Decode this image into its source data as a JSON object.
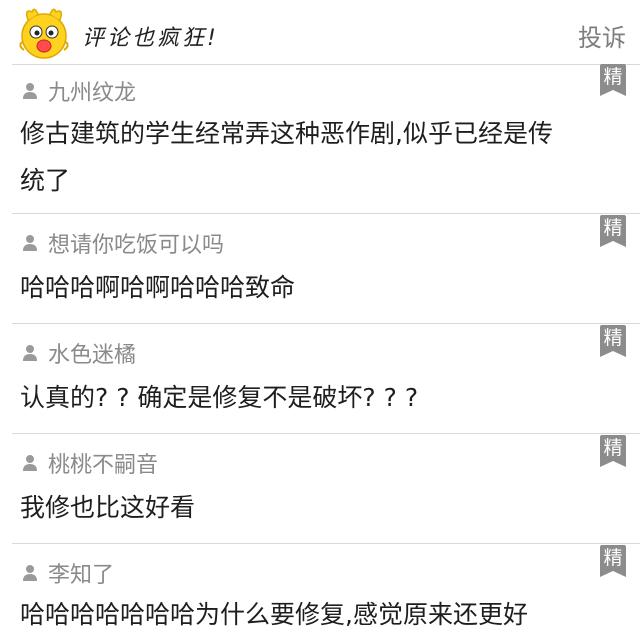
{
  "header": {
    "mascot": "cartoon-chick-mascot",
    "title": "评论也疯狂!",
    "report_label": "投诉"
  },
  "badge_label": "精",
  "comments": [
    {
      "user": "九州纹龙",
      "text_lines": [
        "修古建筑的学生经常弄这种恶作剧,似乎已经是传",
        "统了"
      ]
    },
    {
      "user": "想请你吃饭可以吗",
      "text_lines": [
        "哈哈哈啊哈啊哈哈哈致命"
      ]
    },
    {
      "user": "水色迷橘",
      "text_lines": [
        "认真的? ? 确定是修复不是破坏? ? ?"
      ]
    },
    {
      "user": "桃桃不嗣音",
      "text_lines": [
        "我修也比这好看"
      ]
    },
    {
      "user": "李知了",
      "text_lines": [
        "哈哈哈哈哈哈哈为什么要修复,感觉原来还更好"
      ]
    }
  ],
  "icons": {
    "user": "user-icon",
    "badge": "featured-badge-icon"
  },
  "colors": {
    "badge": "#8c8c8c",
    "username": "#8a8a8a",
    "divider": "#d9d9d9",
    "mascot_yellow": "#ffd21f"
  }
}
